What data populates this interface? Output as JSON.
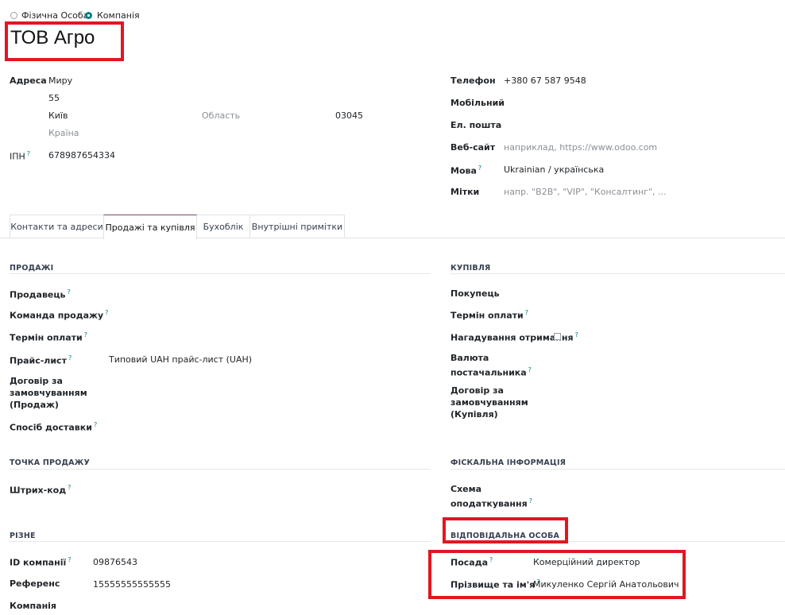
{
  "type_selector": {
    "individual_label": "Фізична Особа",
    "company_label": "Компанія"
  },
  "company_name": "ТОВ Агро",
  "address": {
    "label": "Адреса",
    "street": "Миру",
    "street2": "55",
    "city": "Київ",
    "state_placeholder": "Область",
    "zip": "03045",
    "country_placeholder": "Країна"
  },
  "vat": {
    "label": "ІПН",
    "value": "678987654334"
  },
  "contact": {
    "phone_label": "Телефон",
    "phone_value": "+380 67 587 9548",
    "mobile_label": "Мобільний",
    "email_label": "Ел. пошта",
    "website_label": "Веб-сайт",
    "website_placeholder": "наприклад, https://www.odoo.com",
    "language_label": "Мова",
    "language_value": "Ukrainian / українська",
    "tags_label": "Мітки",
    "tags_placeholder": "напр. \"B2B\", \"VIP\", \"Консалтинг\", ..."
  },
  "tabs": [
    {
      "label": "Контакти та адреси",
      "active": false
    },
    {
      "label": "Продажі та купівля",
      "active": true
    },
    {
      "label": "Бухоблік",
      "active": false
    },
    {
      "label": "Внутрішні примітки",
      "active": false
    }
  ],
  "sales": {
    "heading": "ПРОДАЖІ",
    "salesperson_label": "Продавець",
    "sales_team_label": "Команда продажу",
    "payment_terms_label": "Термін оплати",
    "pricelist_label": "Прайс-лист",
    "pricelist_value": "Типовий UAH прайс-лист (UAH)",
    "blanket_order_label": "Договір за замовчуванням (Продаж)",
    "delivery_method_label": "Спосіб доставки"
  },
  "purchase": {
    "heading": "КУПІВЛЯ",
    "buyer_label": "Покупець",
    "payment_terms_label": "Термін оплати",
    "receipt_reminder_label": "Нагадування отримання",
    "supplier_currency_label": "Валюта постачальника",
    "blanket_order_label": "Договір за замовчуванням (Купівля)"
  },
  "pos": {
    "heading": "ТОЧКА ПРОДАЖУ",
    "barcode_label": "Штрих-код"
  },
  "fiscal": {
    "heading": "ФІСКАЛЬНА ІНФОРМАЦІЯ",
    "tax_scheme_label": "Схема оподаткування"
  },
  "misc": {
    "heading": "РІЗНЕ",
    "company_id_label": "ID компанії",
    "company_id_value": "09876543",
    "reference_label": "Референс",
    "reference_value": "15555555555555",
    "company_label": "Компанія"
  },
  "responsible": {
    "heading": "ВІДПОВІДАЛЬНА ОСОБА",
    "position_label": "Посада",
    "position_value": "Комерційний директор",
    "fullname_label": "Прізвище та ім'я",
    "fullname_value": "Микуленко Сергій Анатольович"
  },
  "help_mark": "?",
  "colors": {
    "accent": "#017e84",
    "tab_active": "#714b67",
    "annotation": "#e3161f"
  }
}
